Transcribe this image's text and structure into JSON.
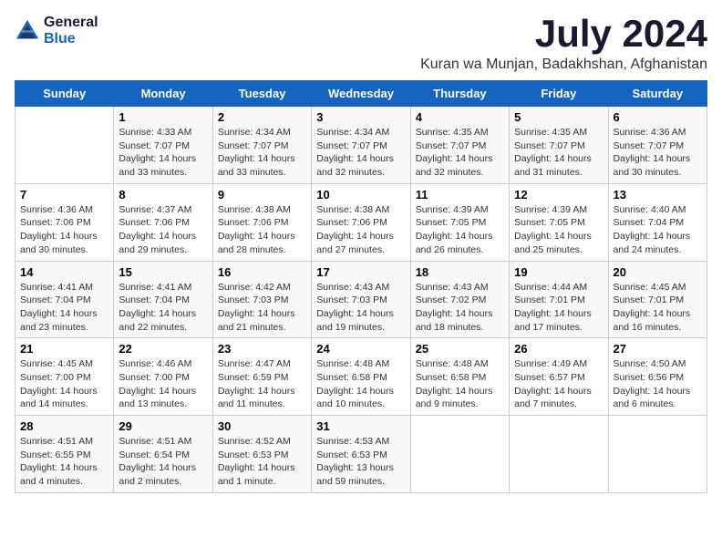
{
  "logo": {
    "general": "General",
    "blue": "Blue"
  },
  "title": {
    "month": "July 2024",
    "location": "Kuran wa Munjan, Badakhshan, Afghanistan"
  },
  "weekdays": [
    "Sunday",
    "Monday",
    "Tuesday",
    "Wednesday",
    "Thursday",
    "Friday",
    "Saturday"
  ],
  "weeks": [
    [
      {
        "day": null
      },
      {
        "day": 1,
        "sunrise": "4:33 AM",
        "sunset": "7:07 PM",
        "daylight": "14 hours and 33 minutes."
      },
      {
        "day": 2,
        "sunrise": "4:34 AM",
        "sunset": "7:07 PM",
        "daylight": "14 hours and 33 minutes."
      },
      {
        "day": 3,
        "sunrise": "4:34 AM",
        "sunset": "7:07 PM",
        "daylight": "14 hours and 32 minutes."
      },
      {
        "day": 4,
        "sunrise": "4:35 AM",
        "sunset": "7:07 PM",
        "daylight": "14 hours and 32 minutes."
      },
      {
        "day": 5,
        "sunrise": "4:35 AM",
        "sunset": "7:07 PM",
        "daylight": "14 hours and 31 minutes."
      },
      {
        "day": 6,
        "sunrise": "4:36 AM",
        "sunset": "7:07 PM",
        "daylight": "14 hours and 30 minutes."
      }
    ],
    [
      {
        "day": 7,
        "sunrise": "4:36 AM",
        "sunset": "7:06 PM",
        "daylight": "14 hours and 30 minutes."
      },
      {
        "day": 8,
        "sunrise": "4:37 AM",
        "sunset": "7:06 PM",
        "daylight": "14 hours and 29 minutes."
      },
      {
        "day": 9,
        "sunrise": "4:38 AM",
        "sunset": "7:06 PM",
        "daylight": "14 hours and 28 minutes."
      },
      {
        "day": 10,
        "sunrise": "4:38 AM",
        "sunset": "7:06 PM",
        "daylight": "14 hours and 27 minutes."
      },
      {
        "day": 11,
        "sunrise": "4:39 AM",
        "sunset": "7:05 PM",
        "daylight": "14 hours and 26 minutes."
      },
      {
        "day": 12,
        "sunrise": "4:39 AM",
        "sunset": "7:05 PM",
        "daylight": "14 hours and 25 minutes."
      },
      {
        "day": 13,
        "sunrise": "4:40 AM",
        "sunset": "7:04 PM",
        "daylight": "14 hours and 24 minutes."
      }
    ],
    [
      {
        "day": 14,
        "sunrise": "4:41 AM",
        "sunset": "7:04 PM",
        "daylight": "14 hours and 23 minutes."
      },
      {
        "day": 15,
        "sunrise": "4:41 AM",
        "sunset": "7:04 PM",
        "daylight": "14 hours and 22 minutes."
      },
      {
        "day": 16,
        "sunrise": "4:42 AM",
        "sunset": "7:03 PM",
        "daylight": "14 hours and 21 minutes."
      },
      {
        "day": 17,
        "sunrise": "4:43 AM",
        "sunset": "7:03 PM",
        "daylight": "14 hours and 19 minutes."
      },
      {
        "day": 18,
        "sunrise": "4:43 AM",
        "sunset": "7:02 PM",
        "daylight": "14 hours and 18 minutes."
      },
      {
        "day": 19,
        "sunrise": "4:44 AM",
        "sunset": "7:01 PM",
        "daylight": "14 hours and 17 minutes."
      },
      {
        "day": 20,
        "sunrise": "4:45 AM",
        "sunset": "7:01 PM",
        "daylight": "14 hours and 16 minutes."
      }
    ],
    [
      {
        "day": 21,
        "sunrise": "4:45 AM",
        "sunset": "7:00 PM",
        "daylight": "14 hours and 14 minutes."
      },
      {
        "day": 22,
        "sunrise": "4:46 AM",
        "sunset": "7:00 PM",
        "daylight": "14 hours and 13 minutes."
      },
      {
        "day": 23,
        "sunrise": "4:47 AM",
        "sunset": "6:59 PM",
        "daylight": "14 hours and 11 minutes."
      },
      {
        "day": 24,
        "sunrise": "4:48 AM",
        "sunset": "6:58 PM",
        "daylight": "14 hours and 10 minutes."
      },
      {
        "day": 25,
        "sunrise": "4:48 AM",
        "sunset": "6:58 PM",
        "daylight": "14 hours and 9 minutes."
      },
      {
        "day": 26,
        "sunrise": "4:49 AM",
        "sunset": "6:57 PM",
        "daylight": "14 hours and 7 minutes."
      },
      {
        "day": 27,
        "sunrise": "4:50 AM",
        "sunset": "6:56 PM",
        "daylight": "14 hours and 6 minutes."
      }
    ],
    [
      {
        "day": 28,
        "sunrise": "4:51 AM",
        "sunset": "6:55 PM",
        "daylight": "14 hours and 4 minutes."
      },
      {
        "day": 29,
        "sunrise": "4:51 AM",
        "sunset": "6:54 PM",
        "daylight": "14 hours and 2 minutes."
      },
      {
        "day": 30,
        "sunrise": "4:52 AM",
        "sunset": "6:53 PM",
        "daylight": "14 hours and 1 minute."
      },
      {
        "day": 31,
        "sunrise": "4:53 AM",
        "sunset": "6:53 PM",
        "daylight": "13 hours and 59 minutes."
      },
      {
        "day": null
      },
      {
        "day": null
      },
      {
        "day": null
      }
    ]
  ]
}
